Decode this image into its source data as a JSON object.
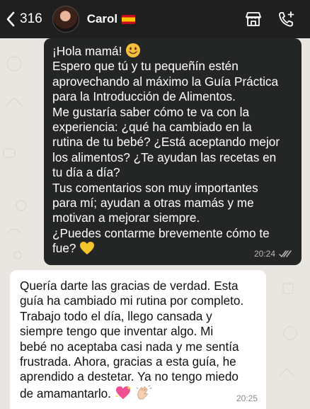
{
  "header": {
    "back_count": "316",
    "contact_name": "Carol",
    "flag_icon": "spain-flag-icon"
  },
  "sent_message": {
    "lines": [
      "¡Hola mamá!",
      "Espero que tú y tu pequeñín estén",
      "aprovechando al máximo la Guía Práctica",
      "para la Introducción de Alimentos.",
      "Me gustaría saber cómo te va con la",
      "experiencia: ¿qué ha cambiado en la",
      "rutina de tu bebé? ¿Está aceptando mejor",
      "los alimentos? ¿Te ayudan las recetas en",
      "tu día a día?",
      "Tus comentarios son muy importantes",
      "para mí; ayudan a otras mamás y me",
      "motivan a mejorar siempre.",
      "¿Puedes contarme brevemente cómo te",
      "fue?"
    ],
    "time": "20:24",
    "status_icon": "read-double-check-icon"
  },
  "received_message": {
    "lines": [
      "Quería darte las gracias de verdad. Esta",
      "guía ha cambiado mi rutina por completo.",
      "Trabajo todo el día, llego cansada y",
      "siempre tengo que inventar algo. Mi",
      "bebé no aceptaba casi nada y me sentía",
      "frustrada. Ahora, gracias a esta guía, he",
      "aprendido a destetar. Ya no tengo miedo",
      "de amamantarlo."
    ],
    "time": "20:25"
  },
  "colors": {
    "header_bg": "#1f1f1f",
    "sent_bubble": "#242626",
    "received_bubble": "#ffffff",
    "chat_bg": "#e9e6e1"
  }
}
